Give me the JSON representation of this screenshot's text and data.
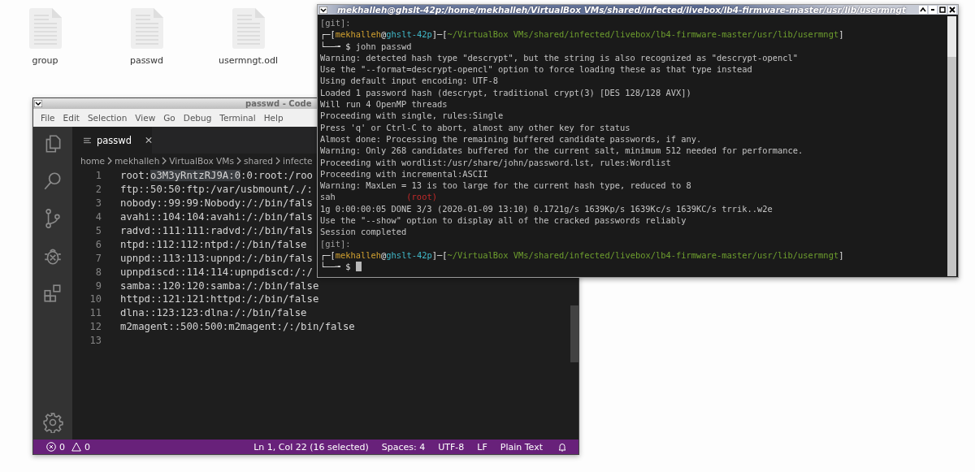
{
  "desktop": {
    "files": [
      {
        "name": "group"
      },
      {
        "name": "passwd"
      },
      {
        "name": "usermngt.odl"
      }
    ]
  },
  "editor": {
    "title": "passwd - Code",
    "menu": [
      "File",
      "Edit",
      "Selection",
      "View",
      "Go",
      "Debug",
      "Terminal",
      "Help"
    ],
    "tab": {
      "label": "passwd"
    },
    "breadcrumb": [
      "home",
      "mekhalleh",
      "VirtualBox VMs",
      "shared",
      "infecte"
    ],
    "lines": [
      {
        "number": "1",
        "parts": [
          {
            "text": "root:",
            "selected": false
          },
          {
            "text": "o3M3yRntzRJ9A:0",
            "selected": true
          },
          {
            "text": ":0:root:/roo",
            "selected": false
          }
        ]
      },
      {
        "number": "2",
        "parts": [
          {
            "text": "ftp::50:50:ftp:/var/usbmount/./:",
            "selected": false
          }
        ]
      },
      {
        "number": "3",
        "parts": [
          {
            "text": "nobody::99:99:Nobody:/:/bin/fals",
            "selected": false
          }
        ]
      },
      {
        "number": "4",
        "parts": [
          {
            "text": "avahi::104:104:avahi:/:/bin/fals",
            "selected": false
          }
        ]
      },
      {
        "number": "5",
        "parts": [
          {
            "text": "radvd::111:111:radvd:/:/bin/fals",
            "selected": false
          }
        ]
      },
      {
        "number": "6",
        "parts": [
          {
            "text": "ntpd::112:112:ntpd:/:/bin/false",
            "selected": false
          }
        ]
      },
      {
        "number": "7",
        "parts": [
          {
            "text": "upnpd::113:113:upnpd:/:/bin/fals",
            "selected": false
          }
        ]
      },
      {
        "number": "8",
        "parts": [
          {
            "text": "upnpdiscd::114:114:upnpdiscd:/:/",
            "selected": false
          }
        ]
      },
      {
        "number": "9",
        "parts": [
          {
            "text": "samba::120:120:samba:/:/bin/false",
            "selected": false
          }
        ]
      },
      {
        "number": "10",
        "parts": [
          {
            "text": "httpd::121:121:httpd:/:/bin/false",
            "selected": false
          }
        ]
      },
      {
        "number": "11",
        "parts": [
          {
            "text": "dlna::123:123:dlna:/:/bin/false",
            "selected": false
          }
        ]
      },
      {
        "number": "12",
        "parts": [
          {
            "text": "m2magent::500:500:m2magent:/:/bin/false",
            "selected": false
          }
        ]
      },
      {
        "number": "13"
      }
    ],
    "status": {
      "errors": "0",
      "warnings": "0",
      "items": [
        "Ln 1, Col 22 (16 selected)",
        "Spaces: 4",
        "UTF-8",
        "LF",
        "Plain Text"
      ]
    }
  },
  "terminal": {
    "title": "mekhalleh@ghslt-42p:/home/mekhalleh/VirtualBox VMs/shared/infected/livebox/lb4-firmware-master/usr/lib/usermngt",
    "lines": [
      {
        "segments": [
          {
            "kind": "git",
            "text": "[git]:"
          }
        ]
      },
      {
        "segments": [
          {
            "kind": "bracket",
            "text": "┌─["
          },
          {
            "kind": "user",
            "text": "mekhalleh"
          },
          {
            "kind": "bracket",
            "text": "@"
          },
          {
            "kind": "host",
            "text": "ghslt-42p"
          },
          {
            "kind": "bracket",
            "text": "]─["
          },
          {
            "kind": "path",
            "text": "~/VirtualBox VMs/shared/infected/livebox/lb4-firmware-master/usr/lib/usermngt"
          },
          {
            "kind": "bracket",
            "text": "]"
          }
        ]
      },
      {
        "segments": [
          {
            "kind": "bracket",
            "text": "└──╼ $"
          },
          {
            "kind": "command",
            "text": "john passwd"
          }
        ]
      },
      {
        "segments": [
          {
            "kind": "plain",
            "text": "Warning: detected hash type \"descrypt\", but the string is also recognized as \"descrypt-opencl\""
          }
        ]
      },
      {
        "segments": [
          {
            "kind": "plain",
            "text": "Use the \"--format=descrypt-opencl\" option to force loading these as that type instead"
          }
        ]
      },
      {
        "segments": [
          {
            "kind": "plain",
            "text": "Using default input encoding: UTF-8"
          }
        ]
      },
      {
        "segments": [
          {
            "kind": "plain",
            "text": "Loaded 1 password hash (descrypt, traditional crypt(3) [DES 128/128 AVX])"
          }
        ]
      },
      {
        "segments": [
          {
            "kind": "plain",
            "text": "Will run 4 OpenMP threads"
          }
        ]
      },
      {
        "segments": [
          {
            "kind": "plain",
            "text": "Proceeding with single, rules:Single"
          }
        ]
      },
      {
        "segments": [
          {
            "kind": "plain",
            "text": "Press 'q' or Ctrl-C to abort, almost any other key for status"
          }
        ]
      },
      {
        "segments": [
          {
            "kind": "plain",
            "text": "Almost done: Processing the remaining buffered candidate passwords, if any."
          }
        ]
      },
      {
        "segments": [
          {
            "kind": "plain",
            "text": "Warning: Only 268 candidates buffered for the current salt, minimum 512 needed for performance."
          }
        ]
      },
      {
        "segments": [
          {
            "kind": "plain",
            "text": "Proceeding with wordlist:/usr/share/john/password.lst, rules:Wordlist"
          }
        ]
      },
      {
        "segments": [
          {
            "kind": "plain",
            "text": "Proceeding with incremental:ASCII"
          }
        ]
      },
      {
        "segments": [
          {
            "kind": "plain",
            "text": "Warning: MaxLen = 13 is too large for the current hash type, reduced to 8"
          }
        ]
      },
      {
        "segments": [
          {
            "kind": "plain",
            "text": "sah"
          },
          {
            "kind": "cracked",
            "text": "(root)"
          }
        ]
      },
      {
        "segments": [
          {
            "kind": "plain",
            "text": "1g 0:00:00:05 DONE 3/3 (2020-01-09 13:10) 0.1721g/s 1639Kp/s 1639Kc/s 1639KC/s trrik..w2e"
          }
        ]
      },
      {
        "segments": [
          {
            "kind": "plain",
            "text": "Use the \"--show\" option to display all of the cracked passwords reliably"
          }
        ]
      },
      {
        "segments": [
          {
            "kind": "plain",
            "text": "Session completed"
          }
        ]
      },
      {
        "segments": [
          {
            "kind": "git",
            "text": "[git]:"
          }
        ]
      },
      {
        "segments": [
          {
            "kind": "bracket",
            "text": "┌─["
          },
          {
            "kind": "user",
            "text": "mekhalleh"
          },
          {
            "kind": "bracket",
            "text": "@"
          },
          {
            "kind": "host",
            "text": "ghslt-42p"
          },
          {
            "kind": "bracket",
            "text": "]─["
          },
          {
            "kind": "path",
            "text": "~/VirtualBox VMs/shared/infected/livebox/lb4-firmware-master/usr/lib/usermngt"
          },
          {
            "kind": "bracket",
            "text": "]"
          }
        ]
      },
      {
        "segments": [
          {
            "kind": "bracket",
            "text": "└──╼ $"
          },
          {
            "kind": "cursor"
          }
        ]
      }
    ]
  }
}
